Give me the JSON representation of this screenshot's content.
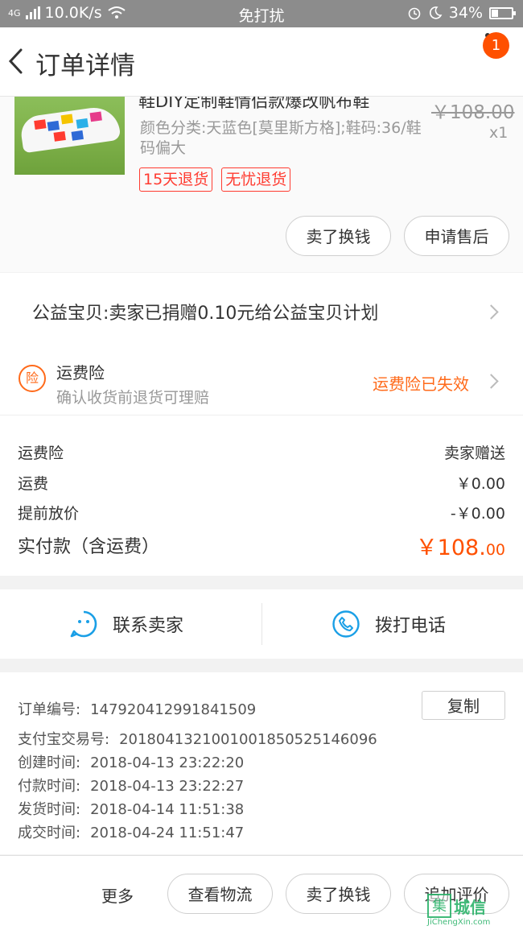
{
  "status_bar": {
    "network": "4G",
    "speed": "10.0K/s",
    "mode": "免打扰",
    "battery": "34%",
    "battery_level": 0.34
  },
  "nav": {
    "title": "订单详情",
    "badge_count": "1"
  },
  "product": {
    "name": "鞋DIY定制鞋情侣款爆改帆布鞋",
    "original_price": "￥108.00",
    "quantity": "x1",
    "sku": "颜色分类:天蓝色[莫里斯方格];鞋码:36/鞋码偏大",
    "tags": [
      "15天退货",
      "无忧退货"
    ],
    "buttons": {
      "sell": "卖了换钱",
      "after_sale": "申请售后"
    }
  },
  "charity": {
    "text": "公益宝贝:卖家已捐赠0.10元给公益宝贝计划"
  },
  "insurance": {
    "icon_text": "险",
    "title": "运费险",
    "desc": "确认收货前退货可理赔",
    "status": "运费险已失效"
  },
  "fees": [
    {
      "label": "运费险",
      "value": "卖家赠送"
    },
    {
      "label": "运费",
      "value": "￥0.00"
    },
    {
      "label": "提前放价",
      "value": "-￥0.00"
    }
  ],
  "paid": {
    "label": "实付款（含运费）",
    "value_main": "￥108.",
    "value_cents": "00"
  },
  "contact": {
    "seller": "联系卖家",
    "call": "拨打电话"
  },
  "order_info": {
    "order_no_label": "订单编号:",
    "order_no": "147920412991841509",
    "copy_label": "复制",
    "alipay_label": "支付宝交易号:",
    "alipay_no": "2018041321001001850525146096",
    "created_label": "创建时间:",
    "created": "2018-04-13 23:22:20",
    "paid_label": "付款时间:",
    "paid_time": "2018-04-13 23:22:27",
    "shipped_label": "发货时间:",
    "shipped": "2018-04-14 11:51:38",
    "closed_label": "成交时间:",
    "closed": "2018-04-24 11:51:47"
  },
  "bottom": {
    "more": "更多",
    "logistics": "查看物流",
    "sell": "卖了换钱",
    "review": "追加评价"
  },
  "watermark": {
    "char": "集",
    "text": "城信",
    "sub": "JiChengXin.com"
  },
  "colors": {
    "accent": "#ff5000",
    "insurance": "#ff6a1a",
    "tag_red": "#ff3b30",
    "icon_blue": "#1a9fe6"
  }
}
